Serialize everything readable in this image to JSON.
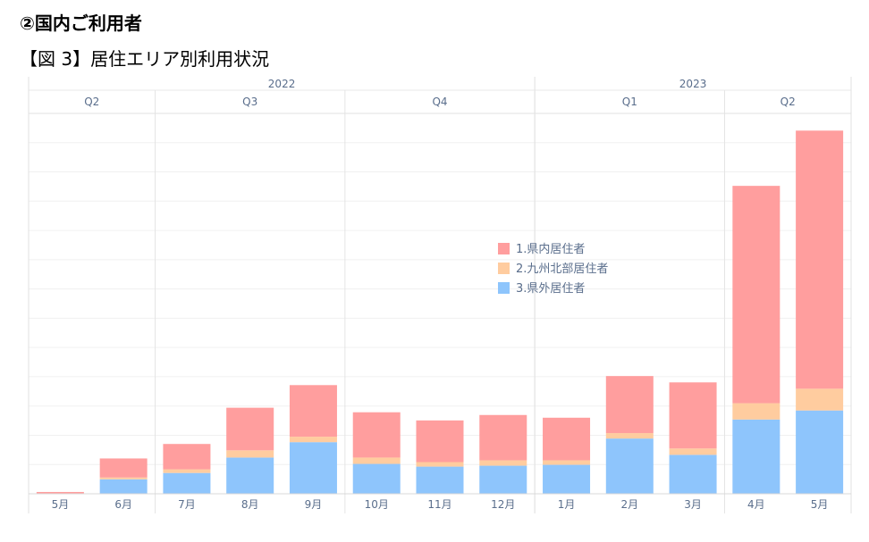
{
  "header": {
    "title": "②国内ご利用者",
    "subtitle": "【図 3】居住エリア別利用状況"
  },
  "chart_data": {
    "type": "bar",
    "stacked": true,
    "categories": [
      "5月",
      "6月",
      "7月",
      "8月",
      "9月",
      "10月",
      "11月",
      "12月",
      "1月",
      "2月",
      "3月",
      "4月",
      "5月"
    ],
    "years": [
      {
        "label": "2022",
        "span": [
          0,
          8
        ]
      },
      {
        "label": "2023",
        "span": [
          8,
          13
        ]
      }
    ],
    "quarters": [
      {
        "label": "Q2",
        "span": [
          0,
          2
        ]
      },
      {
        "label": "Q3",
        "span": [
          2,
          5
        ]
      },
      {
        "label": "Q4",
        "span": [
          5,
          8
        ]
      },
      {
        "label": "Q1",
        "span": [
          8,
          11
        ]
      },
      {
        "label": "Q2",
        "span": [
          11,
          13
        ]
      }
    ],
    "series": [
      {
        "name": "3.県外居住者",
        "color": "#8ec5fc",
        "values": [
          0,
          16,
          23,
          40,
          57,
          33,
          30,
          31,
          32,
          61,
          43,
          82,
          92
        ]
      },
      {
        "name": "2.九州北部居住者",
        "color": "#ffcc9f",
        "values": [
          0,
          2,
          4,
          8,
          6,
          7,
          5,
          6,
          5,
          6,
          7,
          18,
          24
        ]
      },
      {
        "name": "1.県内居住者",
        "color": "#ff9e9e",
        "values": [
          2,
          21,
          28,
          47,
          57,
          50,
          46,
          50,
          47,
          63,
          73,
          240,
          285
        ]
      }
    ],
    "ylim": [
      0,
      420
    ],
    "grid": true,
    "legend_position": "center"
  }
}
